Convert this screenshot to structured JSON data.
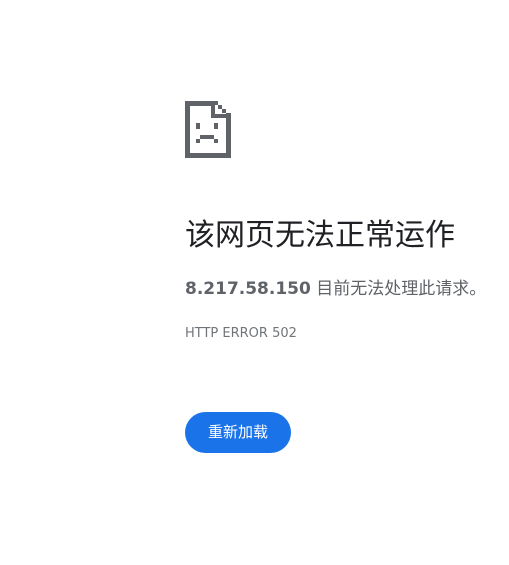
{
  "error": {
    "icon": "sad-file-icon",
    "title": "该网页无法正常运作",
    "host": "8.217.58.150",
    "message_suffix": "目前无法处理此请求。",
    "code": "HTTP ERROR 502",
    "reload_label": "重新加载"
  },
  "colors": {
    "background": "#ffffff",
    "title_text": "#202124",
    "body_text": "#5f6368",
    "code_text": "#70757a",
    "button_bg": "#1a73e8",
    "button_text": "#ffffff",
    "icon": "#5f6368"
  }
}
